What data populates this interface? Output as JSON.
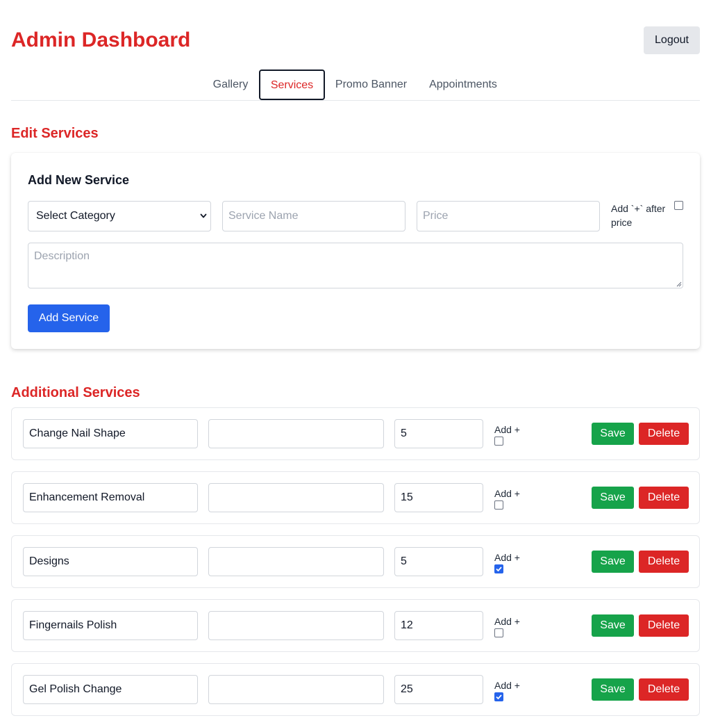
{
  "header": {
    "title": "Admin Dashboard",
    "logout_label": "Logout"
  },
  "tabs": [
    {
      "label": "Gallery",
      "active": false
    },
    {
      "label": "Services",
      "active": true
    },
    {
      "label": "Promo Banner",
      "active": false
    },
    {
      "label": "Appointments",
      "active": false
    }
  ],
  "edit_services": {
    "title": "Edit Services",
    "add_form": {
      "title": "Add New Service",
      "category_select": {
        "value": "Select Category",
        "icon": "chevron-down-icon"
      },
      "service_name_placeholder": "Service Name",
      "price_placeholder": "Price",
      "plus_after_price_label": "Add `+` after price",
      "plus_after_price_checked": false,
      "description_placeholder": "Description",
      "submit_label": "Add Service"
    }
  },
  "additional_services": {
    "title": "Additional Services",
    "add_plus_label": "Add +",
    "save_label": "Save",
    "delete_label": "Delete",
    "items": [
      {
        "name": "Change Nail Shape",
        "description": "",
        "price": "5",
        "add_plus": false
      },
      {
        "name": "Enhancement Removal",
        "description": "",
        "price": "15",
        "add_plus": false
      },
      {
        "name": "Designs",
        "description": "",
        "price": "5",
        "add_plus": true
      },
      {
        "name": "Fingernails Polish",
        "description": "",
        "price": "12",
        "add_plus": false
      },
      {
        "name": "Gel Polish Change",
        "description": "",
        "price": "25",
        "add_plus": true
      }
    ]
  },
  "colors": {
    "brand_red": "#dc2626",
    "primary_blue": "#2563eb",
    "save_green": "#16a34a"
  }
}
